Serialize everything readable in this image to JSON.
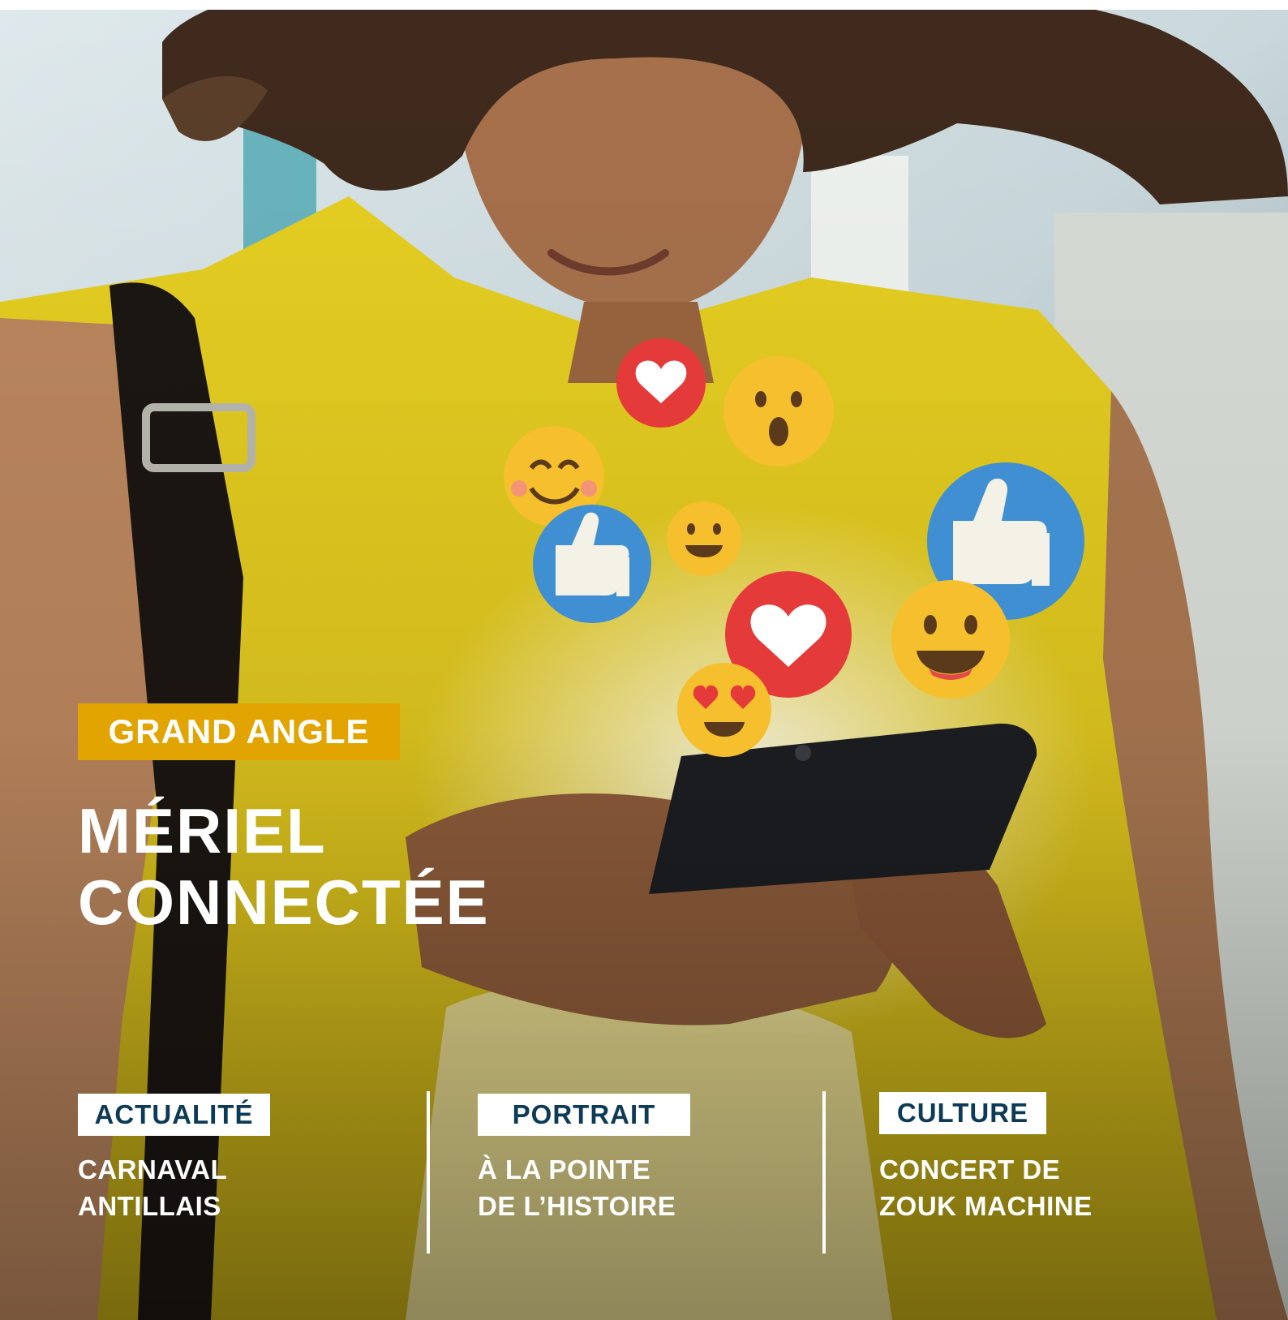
{
  "main_feature": {
    "section": "GRAND ANGLE",
    "title_line1": "MÉRIEL",
    "title_line2": "CONNECTÉE"
  },
  "rubriques": [
    {
      "tag": "ACTUALITÉ",
      "line1": "CARNAVAL",
      "line2": "ANTILLAIS"
    },
    {
      "tag": "PORTRAIT",
      "line1": "À LA POINTE",
      "line2": "DE L’HISTOIRE"
    },
    {
      "tag": "CULTURE",
      "line1": "CONCERT DE",
      "line2": "ZOUK MACHINE"
    }
  ],
  "colors": {
    "accent": "#e2a400",
    "tag_text": "#0d3a56",
    "shirt": "#e0c81e",
    "like_blue": "#3f8fd2",
    "heart_red": "#e53a3a",
    "emoji_yellow": "#f5bf2e"
  },
  "icons": [
    "heart-icon",
    "surprised-emoji-icon",
    "smile-emoji-icon",
    "thumbs-up-icon",
    "grin-emoji-icon",
    "heart-eyes-emoji-icon",
    "smartphone-icon"
  ]
}
